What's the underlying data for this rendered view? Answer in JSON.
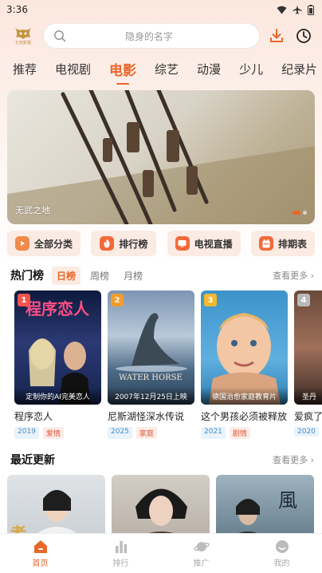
{
  "status": {
    "time": "3:36"
  },
  "header": {
    "logo_text": "七天影视",
    "search_placeholder": "隐身的名字"
  },
  "tabs": [
    "推荐",
    "电视剧",
    "电影",
    "综艺",
    "动漫",
    "少儿",
    "纪录片"
  ],
  "active_tab": "电影",
  "banner": {
    "caption": "无武之地"
  },
  "quick": [
    {
      "label": "全部分类",
      "icon": "play-square-icon"
    },
    {
      "label": "排行榜",
      "icon": "flame-icon"
    },
    {
      "label": "电视直播",
      "icon": "tv-icon"
    },
    {
      "label": "排期表",
      "icon": "calendar-icon"
    }
  ],
  "hot": {
    "title": "热门榜",
    "tabs": [
      "日榜",
      "周榜",
      "月榜"
    ],
    "more": "查看更多 ›",
    "items": [
      {
        "rank": "1",
        "title": "程序恋人",
        "note": "定制你的AI完美恋人",
        "year": "2019",
        "genre": "爱情",
        "badge_color": "#f0544c"
      },
      {
        "rank": "2",
        "title": "尼斯湖怪深水传说",
        "note": "2007年12月25日上映",
        "year": "2025",
        "genre": "家庭",
        "badge_color": "#f39c2c"
      },
      {
        "rank": "3",
        "title": "这个男孩必须被释放",
        "note": "德国治愈家庭教育片",
        "year": "2021",
        "genre": "剧情",
        "badge_color": "#f5b82e"
      },
      {
        "rank": "4",
        "title": "爱疯了",
        "note": "圣丹",
        "year": "2020",
        "genre": "",
        "badge_color": "#b9b9b9"
      }
    ]
  },
  "recent": {
    "title": "最近更新",
    "more": "查看更多 ›"
  },
  "nav": [
    {
      "label": "首页",
      "icon": "home-icon"
    },
    {
      "label": "排行",
      "icon": "bar-chart-icon"
    },
    {
      "label": "推广",
      "icon": "planet-icon"
    },
    {
      "label": "我的",
      "icon": "smile-icon"
    }
  ],
  "colors": {
    "accent": "#e8672b",
    "quick_bg": "#fcebe3"
  }
}
